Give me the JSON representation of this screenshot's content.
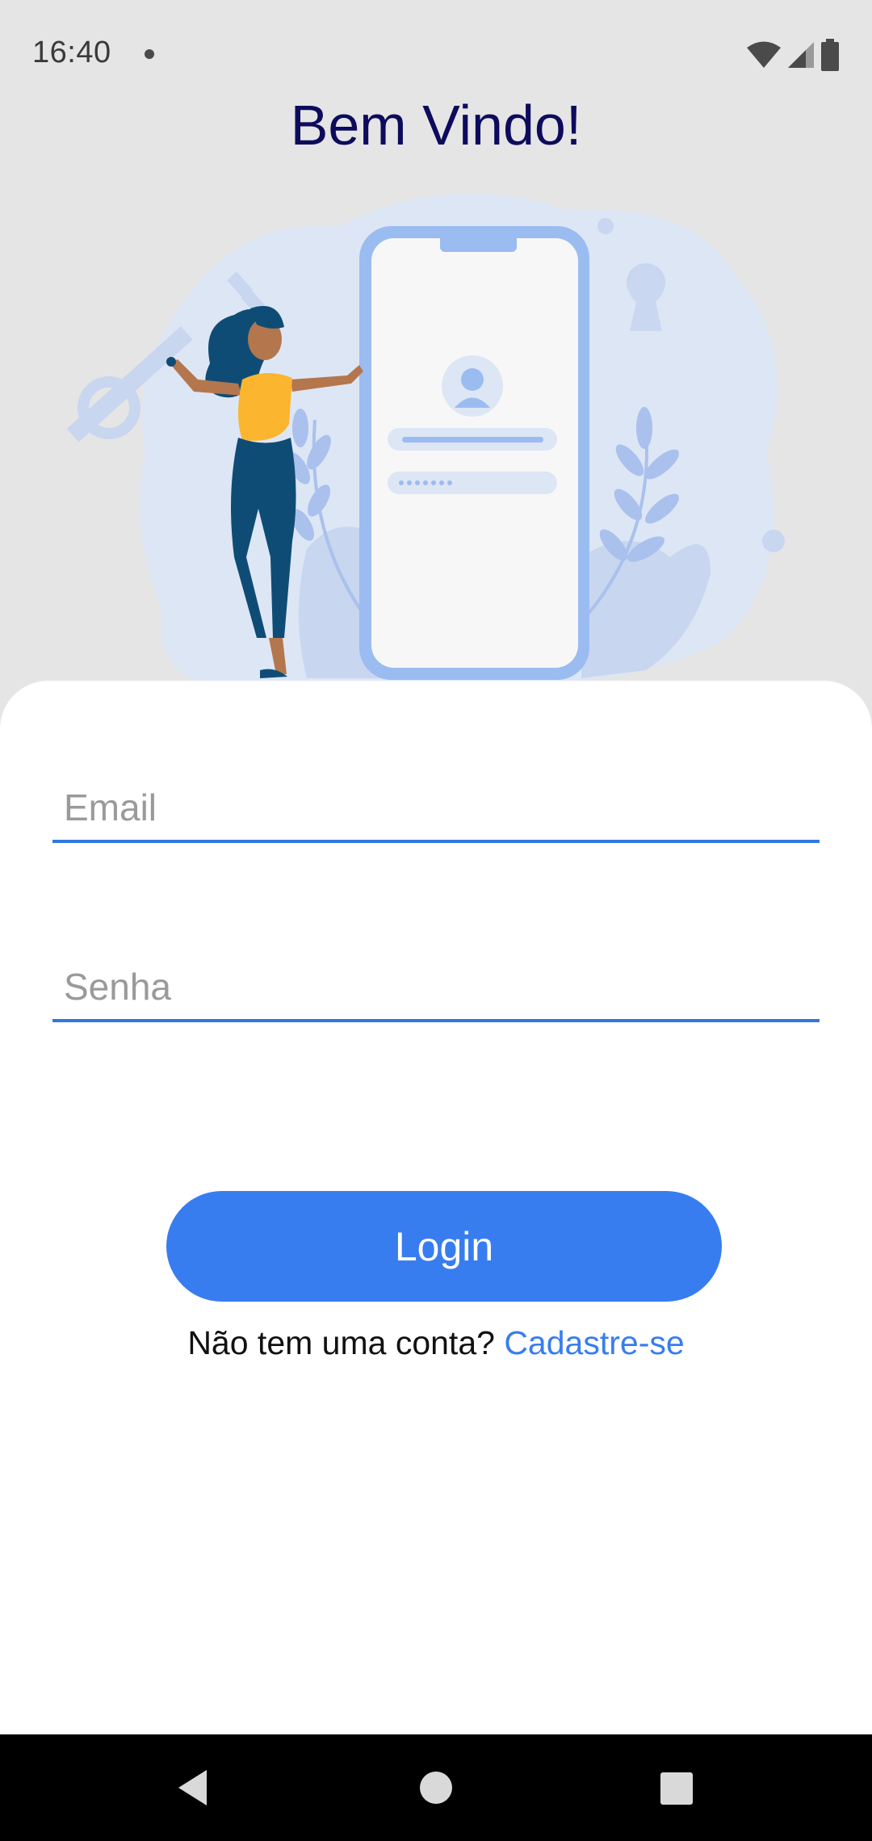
{
  "status_bar": {
    "time": "16:40",
    "icons": [
      "notification-dot-icon",
      "wifi-icon",
      "cell-signal-icon",
      "battery-icon"
    ]
  },
  "header": {
    "title": "Bem Vindo!"
  },
  "illustration": {
    "description_icons": [
      "woman-figure",
      "phone-login-screen",
      "key-icon",
      "plant-leaves"
    ]
  },
  "form": {
    "email_placeholder": "Email",
    "password_placeholder": "Senha",
    "login_label": "Login",
    "signup_prompt": "Não tem uma conta?",
    "signup_link": "Cadastre-se"
  },
  "nav": {
    "icons": [
      "back-icon",
      "home-icon",
      "recents-icon"
    ]
  },
  "colors": {
    "primary": "#387df0",
    "title": "#0d0b5c",
    "background": "#e5e5e5",
    "card": "#ffffff",
    "underline": "#3278e0"
  }
}
